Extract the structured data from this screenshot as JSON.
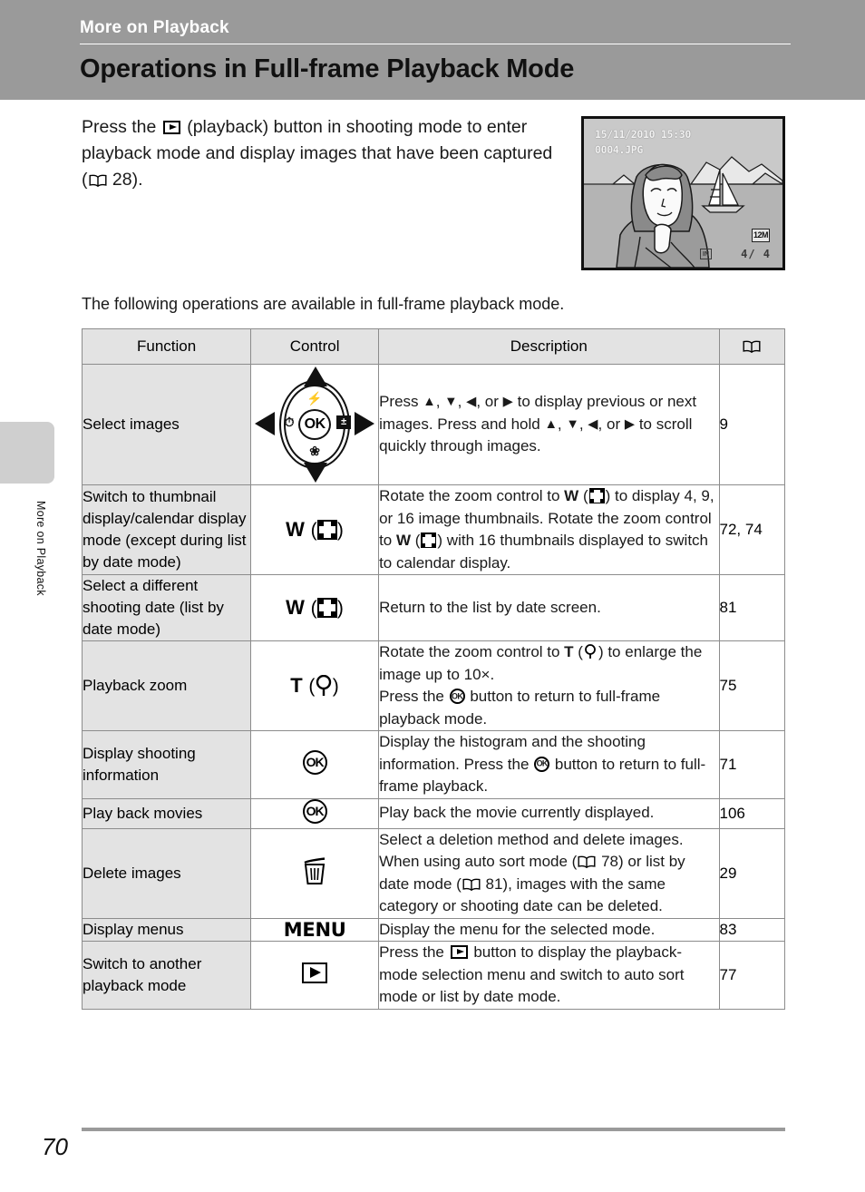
{
  "header": {
    "chapter": "More on Playback",
    "title": "Operations in Full-frame Playback Mode"
  },
  "side_tab": {
    "label": "More on Playback"
  },
  "intro": {
    "part1": "Press the ",
    "icon1": "playback-button-icon",
    "part2": " (playback) button in shooting mode to enter playback mode and display images that have been captured (",
    "icon2": "book-reference-icon",
    "ref_page": " 28).",
    "part3": ""
  },
  "body_text": "The following operations are available in full-frame playback mode.",
  "camera_screen": {
    "datetime": "15/11/2010 15:30",
    "filename": "0004.JPG",
    "frame_counter": "4/  4",
    "memory_indicator": "IN",
    "image_size_badge": "12M"
  },
  "table": {
    "headers": {
      "function": "Function",
      "control": "Control",
      "description": "Description",
      "reference": "book-reference-icon"
    },
    "rows": [
      {
        "function": "Select images",
        "control_type": "multi-selector",
        "control_label": "",
        "description_segments": [
          {
            "t": "text",
            "v": "Press "
          },
          {
            "t": "tri",
            "v": "▲"
          },
          {
            "t": "text",
            "v": ", "
          },
          {
            "t": "tri",
            "v": "▼"
          },
          {
            "t": "text",
            "v": ", "
          },
          {
            "t": "tri",
            "v": "◀"
          },
          {
            "t": "text",
            "v": ", or "
          },
          {
            "t": "tri",
            "v": "▶"
          },
          {
            "t": "text",
            "v": " to display previous or next images. Press and hold "
          },
          {
            "t": "tri",
            "v": "▲"
          },
          {
            "t": "text",
            "v": ", "
          },
          {
            "t": "tri",
            "v": "▼"
          },
          {
            "t": "text",
            "v": ", "
          },
          {
            "t": "tri",
            "v": "◀"
          },
          {
            "t": "text",
            "v": ", or "
          },
          {
            "t": "tri",
            "v": "▶"
          },
          {
            "t": "text",
            "v": " to scroll quickly through images."
          }
        ],
        "reference": "9"
      },
      {
        "function": "Switch to thumbnail display/calendar display mode (except during list by date mode)",
        "control_type": "w-thumbnail",
        "control_label": "W",
        "description_segments": [
          {
            "t": "text",
            "v": "Rotate the zoom control to "
          },
          {
            "t": "bold",
            "v": "W"
          },
          {
            "t": "text",
            "v": " ("
          },
          {
            "t": "thumb",
            "v": ""
          },
          {
            "t": "text",
            "v": ") to display 4, 9, or 16 image thumbnails. Rotate the zoom control to "
          },
          {
            "t": "bold",
            "v": "W"
          },
          {
            "t": "text",
            "v": " ("
          },
          {
            "t": "thumb",
            "v": ""
          },
          {
            "t": "text",
            "v": ") with 16 thumbnails displayed to switch to calendar display."
          }
        ],
        "reference": "72, 74"
      },
      {
        "function": "Select a different shooting date (list by date mode)",
        "control_type": "w-thumbnail",
        "control_label": "W",
        "description_segments": [
          {
            "t": "text",
            "v": "Return to the list by date screen."
          }
        ],
        "reference": "81"
      },
      {
        "function": "Playback zoom",
        "control_type": "t-magnify",
        "control_label": "T",
        "description_segments": [
          {
            "t": "text",
            "v": "Rotate the zoom control to "
          },
          {
            "t": "bold",
            "v": "T"
          },
          {
            "t": "text",
            "v": " ("
          },
          {
            "t": "mag",
            "v": ""
          },
          {
            "t": "text",
            "v": ") to enlarge the image up to 10×."
          },
          {
            "t": "br",
            "v": ""
          },
          {
            "t": "text",
            "v": "Press the "
          },
          {
            "t": "ok",
            "v": ""
          },
          {
            "t": "text",
            "v": " button to return to full-frame playback mode."
          }
        ],
        "reference": "75"
      },
      {
        "function": "Display shooting information",
        "control_type": "ok-button",
        "control_label": "OK",
        "description_segments": [
          {
            "t": "text",
            "v": "Display the histogram and the shooting information. Press the "
          },
          {
            "t": "ok",
            "v": ""
          },
          {
            "t": "text",
            "v": " button to return to full-frame playback."
          }
        ],
        "reference": "71"
      },
      {
        "function": "Play back movies",
        "control_type": "ok-button",
        "control_label": "OK",
        "description_segments": [
          {
            "t": "text",
            "v": "Play back the movie currently displayed."
          }
        ],
        "reference": "106"
      },
      {
        "function": "Delete images",
        "control_type": "trash",
        "control_label": "",
        "description_segments": [
          {
            "t": "text",
            "v": "Select a deletion method and delete images. When using auto sort mode ("
          },
          {
            "t": "book",
            "v": ""
          },
          {
            "t": "text",
            "v": " 78) or list by date mode ("
          },
          {
            "t": "book",
            "v": ""
          },
          {
            "t": "text",
            "v": " 81), images with the same category or shooting date can be deleted."
          }
        ],
        "reference": "29"
      },
      {
        "function": "Display menus",
        "control_type": "menu",
        "control_label": "MENU",
        "description_segments": [
          {
            "t": "text",
            "v": "Display the menu for the selected mode."
          }
        ],
        "reference": "83"
      },
      {
        "function": "Switch to another playback mode",
        "control_type": "play-button",
        "control_label": "",
        "description_segments": [
          {
            "t": "text",
            "v": "Press the "
          },
          {
            "t": "play",
            "v": ""
          },
          {
            "t": "text",
            "v": " button to display the playback-mode selection menu and switch to auto sort mode or list by date mode."
          }
        ],
        "reference": "77"
      }
    ]
  },
  "footer": {
    "page_number": "70"
  },
  "colors": {
    "header_band": "#9a9a9a",
    "table_header_bg": "#e3e3e3",
    "function_col_bg": "#e3e3e3",
    "border": "#8c8c8c",
    "tab_gray": "#cfcfcf"
  }
}
